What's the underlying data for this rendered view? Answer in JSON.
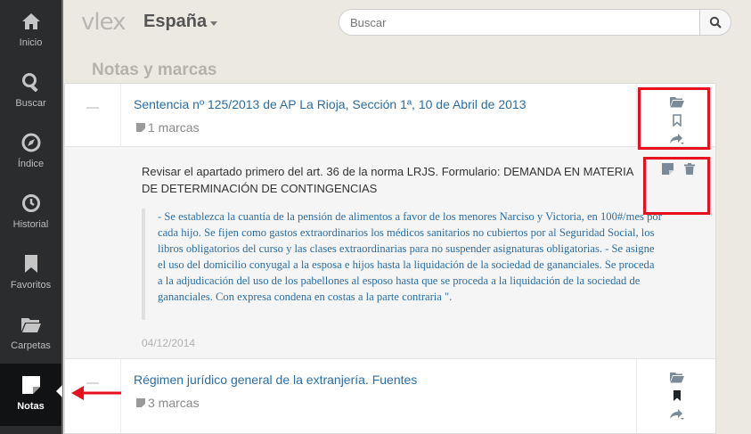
{
  "sidebar": {
    "items": [
      {
        "label": "Inicio",
        "icon": "home-icon"
      },
      {
        "label": "Buscar",
        "icon": "search-icon"
      },
      {
        "label": "Índice",
        "icon": "compass-icon"
      },
      {
        "label": "Historial",
        "icon": "history-icon"
      },
      {
        "label": "Favoritos",
        "icon": "bookmark-icon"
      },
      {
        "label": "Carpetas",
        "icon": "folder-icon"
      },
      {
        "label": "Notas",
        "icon": "note-icon",
        "active": true
      }
    ]
  },
  "header": {
    "logo": "vlex",
    "country": "España",
    "search_placeholder": "Buscar"
  },
  "page_title": "Notas y marcas",
  "documents": [
    {
      "title": "Sentencia nº 125/2013 de AP La Rioja, Sección 1ª, 10 de Abril de 2013",
      "marks": "1 marcas",
      "bookmarked": false,
      "note": {
        "title": "Revisar el apartado primero del art. 36 de la norma LRJS. Formulario: DEMANDA EN MATERIA DE DETERMINACIÓN DE CONTINGENCIAS",
        "quote": "- Se establezca la cuantía de la pensión de alimentos a favor de los menores Narciso y Victoria, en 100#/mes por cada hijo. Se fijen como gastos extraordinarios los médicos sanitarios no cubiertos por al Seguridad Social, los libros obligatorios del curso y las clases extraordinarias para no suspender asignaturas obligatorias. - Se asigne el uso del domicilio conyugal a la esposa e hijos hasta la liquidación de la sociedad de gananciales. Se proceda a la adjudicación del uso de los pabellones al esposo hasta que se proceda a la liquidación de la sociedad de gananciales. Con expresa condena en costas a la parte contraria \".",
        "date": "04/12/2014"
      }
    },
    {
      "title": "Régimen jurídico general de la extranjería. Fuentes",
      "marks": "3 marcas",
      "bookmarked": true
    }
  ],
  "colors": {
    "link": "#2b6ea3",
    "highlight": "#e8101e",
    "sidebar": "#2a2c2e"
  }
}
